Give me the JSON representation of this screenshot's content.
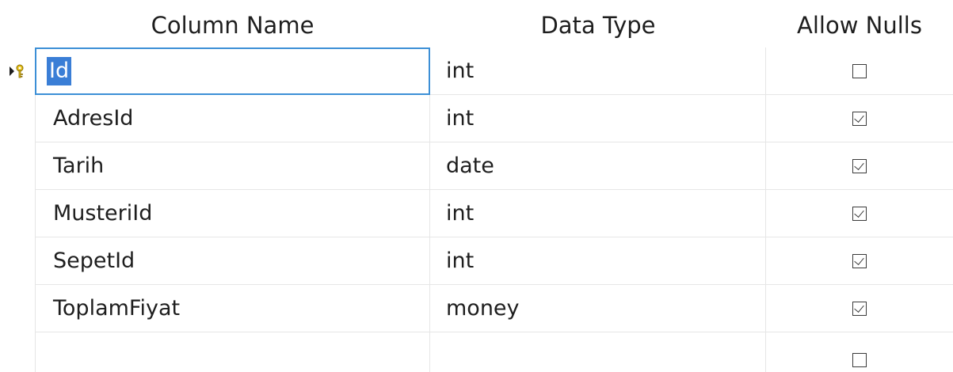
{
  "headers": {
    "column_name": "Column Name",
    "data_type": "Data Type",
    "allow_nulls": "Allow Nulls"
  },
  "rows": [
    {
      "name": "Id",
      "type": "int",
      "allow_nulls": false,
      "primary_key": true
    },
    {
      "name": "AdresId",
      "type": "int",
      "allow_nulls": true
    },
    {
      "name": "Tarih",
      "type": "date",
      "allow_nulls": true
    },
    {
      "name": "MusteriId",
      "type": "int",
      "allow_nulls": true
    },
    {
      "name": "SepetId",
      "type": "int",
      "allow_nulls": true
    },
    {
      "name": "ToplamFiyat",
      "type": "money",
      "allow_nulls": true
    },
    {
      "name": "",
      "type": "",
      "allow_nulls": false
    }
  ],
  "icons": {
    "row_selector": "primary-key-arrow-icon"
  },
  "colors": {
    "selection": "#3a7ed6",
    "focus_border": "#3c8fd6",
    "key_yellow": "#e8c21a"
  }
}
